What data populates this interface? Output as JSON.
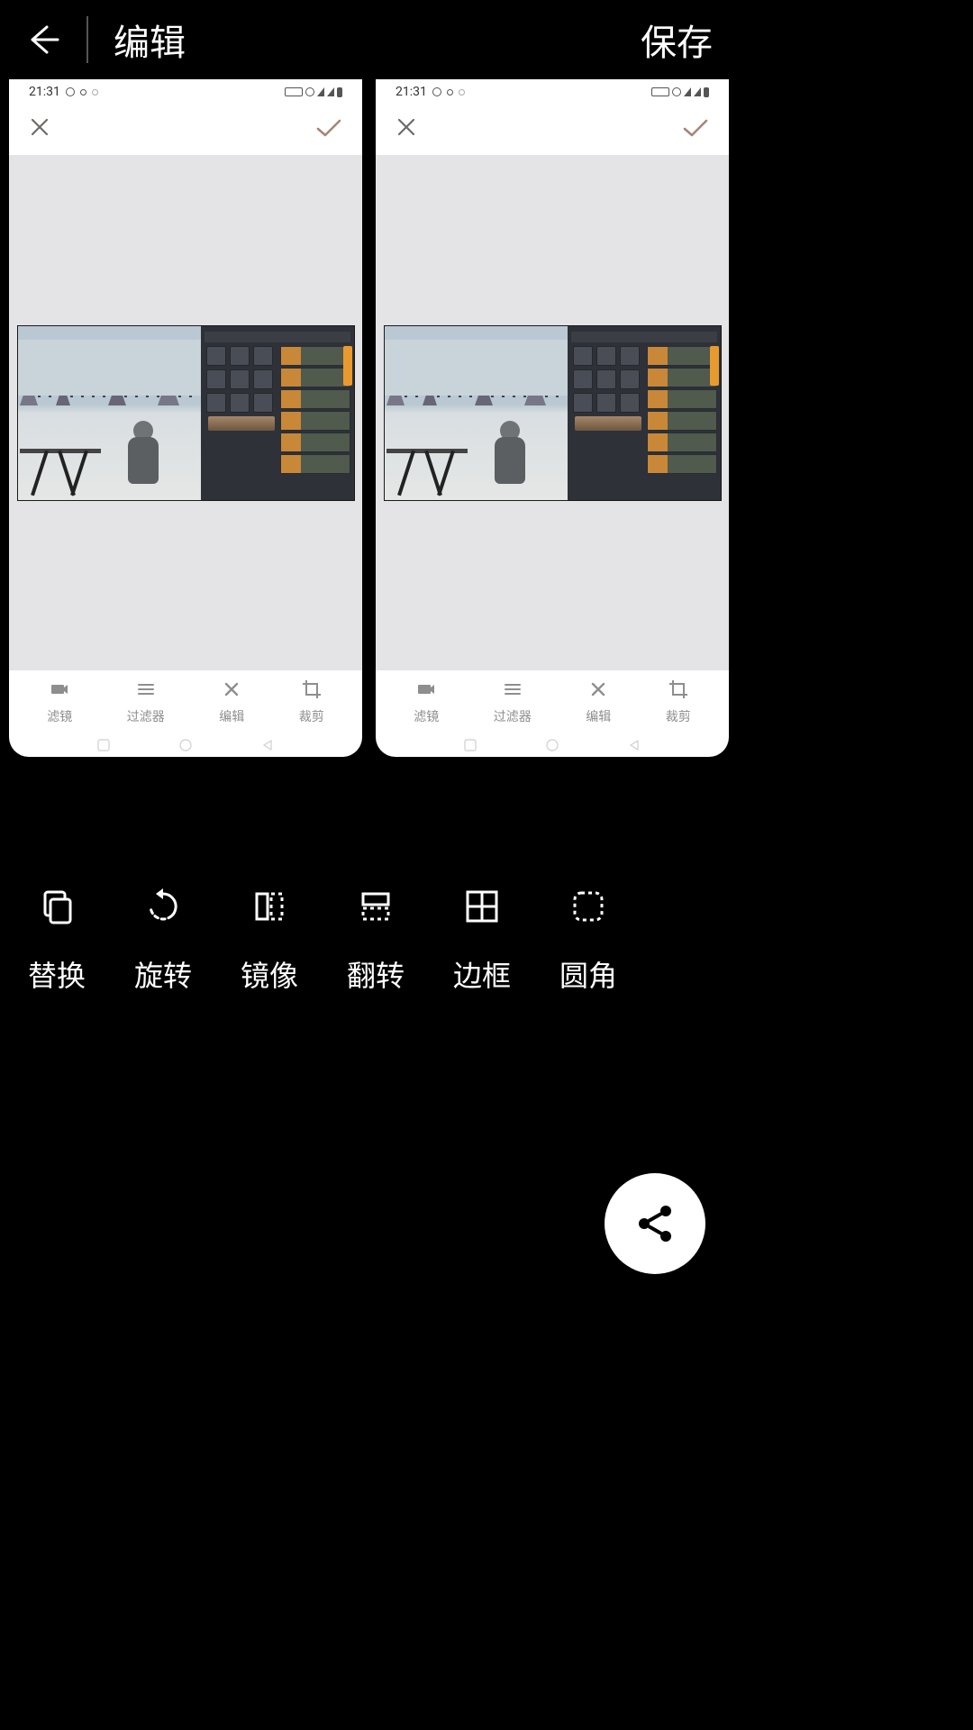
{
  "header": {
    "title": "编辑",
    "save": "保存"
  },
  "preview_time": "21:31",
  "inner_tools": [
    {
      "key": "filter",
      "label": "滤镜"
    },
    {
      "key": "filters",
      "label": "过滤器"
    },
    {
      "key": "edit",
      "label": "编辑"
    },
    {
      "key": "crop",
      "label": "裁剪"
    }
  ],
  "edit_tools": [
    {
      "key": "replace",
      "label": "替换"
    },
    {
      "key": "rotate",
      "label": "旋转"
    },
    {
      "key": "mirror",
      "label": "镜像"
    },
    {
      "key": "flip",
      "label": "翻转"
    },
    {
      "key": "border",
      "label": "边框"
    },
    {
      "key": "round",
      "label": "圆角"
    }
  ]
}
